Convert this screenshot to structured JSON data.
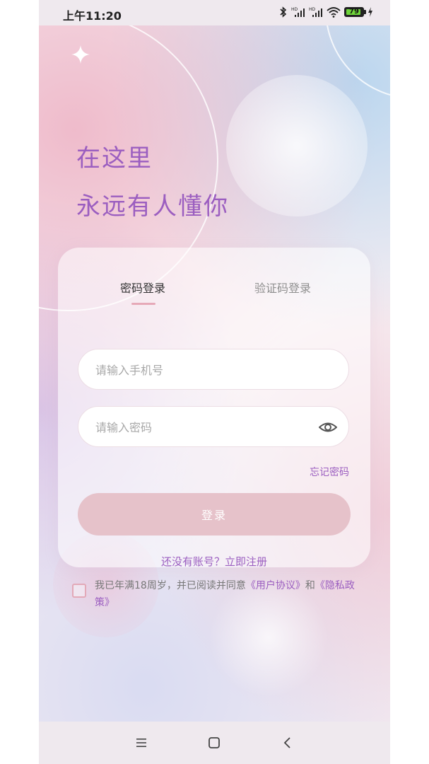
{
  "status_bar": {
    "time": "上午11:20",
    "battery_level": "79"
  },
  "hero": {
    "line1": "在这里",
    "line2": "永远有人懂你"
  },
  "login_card": {
    "tabs": [
      {
        "label": "密码登录",
        "active": true
      },
      {
        "label": "验证码登录",
        "active": false
      }
    ],
    "phone_placeholder": "请输入手机号",
    "password_placeholder": "请输入密码",
    "forgot_password": "忘记密码",
    "login_button": "登录",
    "register_link": "还没有账号？立即注册"
  },
  "agreement": {
    "text_before": "我已年满18周岁，并已阅读并同意",
    "user_agreement": "《用户协议》",
    "conjunction": "和",
    "privacy_policy": "《隐私政策》",
    "checked": false
  },
  "icons": {
    "sparkle": "sparkle-icon",
    "eye": "eye-icon",
    "bluetooth": "bluetooth-icon",
    "signal": "signal-icon",
    "wifi": "wifi-icon",
    "battery": "battery-icon",
    "charging": "charging-icon",
    "nav_menu": "menu-icon",
    "nav_home": "home-icon",
    "nav_back": "back-icon"
  },
  "colors": {
    "accent_purple": "#9b5ec0",
    "button_pink": "#e6c2ca",
    "tab_underline": "#e6a9b8"
  }
}
